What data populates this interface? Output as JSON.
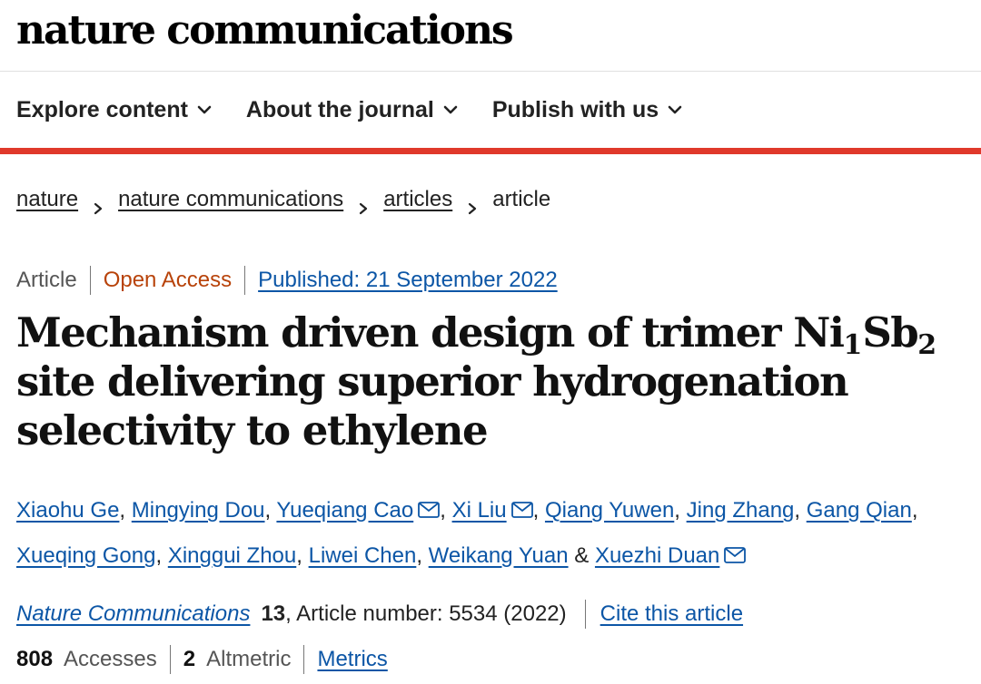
{
  "header": {
    "logo": "nature communications"
  },
  "nav": {
    "items": [
      {
        "label": "Explore content",
        "icon": "chevron-down-icon"
      },
      {
        "label": "About the journal",
        "icon": "chevron-down-icon"
      },
      {
        "label": "Publish with us",
        "icon": "chevron-down-icon"
      }
    ]
  },
  "colors": {
    "accent_bar": "#e0392b",
    "link": "#0c56a6",
    "open_access": "#b8430a"
  },
  "breadcrumb": {
    "items": [
      "nature",
      "nature communications",
      "articles"
    ],
    "current": "article"
  },
  "article": {
    "type": "Article",
    "access": "Open Access",
    "published": "Published: 21 September 2022",
    "title_part1": "Mechanism driven design of trimer Ni",
    "title_sub1": "1",
    "title_part2": "Sb",
    "title_sub2": "2",
    "title_part3": " site delivering superior hydrogenation selectivity to ethylene",
    "authors": [
      {
        "name": "Xiaohu Ge",
        "mail": false
      },
      {
        "name": "Mingying Dou",
        "mail": false
      },
      {
        "name": "Yueqiang Cao",
        "mail": true
      },
      {
        "name": "Xi Liu",
        "mail": true
      },
      {
        "name": "Qiang Yuwen",
        "mail": false
      },
      {
        "name": "Jing Zhang",
        "mail": false
      },
      {
        "name": "Gang Qian",
        "mail": false
      },
      {
        "name": "Xueqing Gong",
        "mail": false
      },
      {
        "name": "Xinggui Zhou",
        "mail": false
      },
      {
        "name": "Liwei Chen",
        "mail": false
      },
      {
        "name": "Weikang Yuan",
        "mail": false
      },
      {
        "name": "Xuezhi Duan",
        "mail": true
      }
    ],
    "ampersand": "&",
    "comma": ",",
    "journal": "Nature Communications",
    "volume": "13",
    "article_number": ", Article number: 5534 (2022)",
    "cite_label": "Cite this article",
    "accesses_count": "808",
    "accesses_label": "Accesses",
    "altmetric_count": "2",
    "altmetric_label": "Altmetric",
    "metrics_label": "Metrics"
  }
}
